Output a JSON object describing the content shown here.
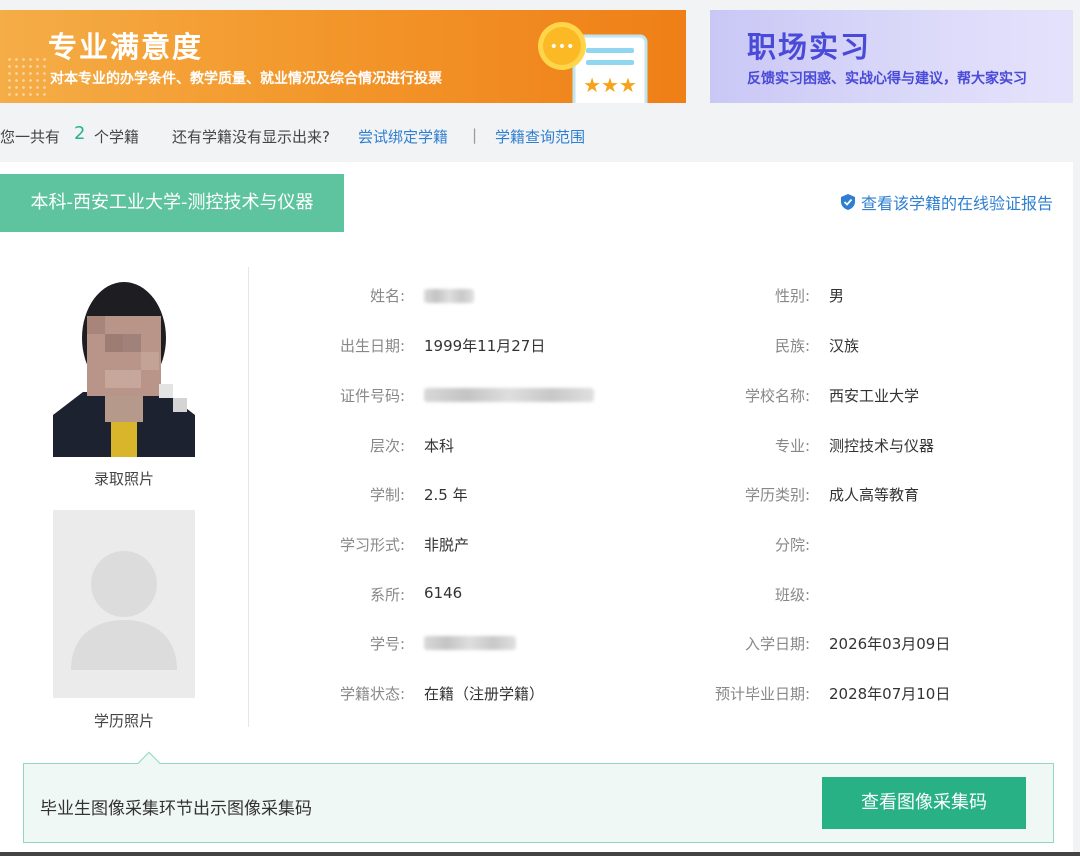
{
  "banners": {
    "satisfaction": {
      "title": "专业满意度",
      "subtitle": "对本专业的办学条件、教学质量、就业情况及综合情况进行投票",
      "bubble_text": "•••"
    },
    "internship": {
      "title": "职场实习",
      "subtitle": "反馈实习困惑、实战心得与建议，帮大家实习"
    }
  },
  "summary": {
    "prefix": "您一共有",
    "count": "2",
    "suffix": "个学籍",
    "hint": "还有学籍没有显示出来?",
    "bind_link": "尝试绑定学籍",
    "separator": "|",
    "scope_link": "学籍查询范围"
  },
  "record": {
    "tab_label": "本科-西安工业大学-测控技术与仪器",
    "verify_link": "查看该学籍的在线验证报告",
    "admission_photo_label": "录取照片",
    "degree_photo_label": "学历照片",
    "fields_left": [
      {
        "label": "姓名:",
        "value": ""
      },
      {
        "label": "出生日期:",
        "value": "1999年11月27日"
      },
      {
        "label": "证件号码:",
        "value": ""
      },
      {
        "label": "层次:",
        "value": "本科"
      },
      {
        "label": "学制:",
        "value": "2.5 年"
      },
      {
        "label": "学习形式:",
        "value": "非脱产"
      },
      {
        "label": "系所:",
        "value": "6146"
      },
      {
        "label": "学号:",
        "value": ""
      },
      {
        "label": "学籍状态:",
        "value": "在籍（注册学籍）"
      }
    ],
    "fields_right": [
      {
        "label": "性别:",
        "value": "男"
      },
      {
        "label": "民族:",
        "value": "汉族"
      },
      {
        "label": "学校名称:",
        "value": "西安工业大学"
      },
      {
        "label": "专业:",
        "value": "测控技术与仪器"
      },
      {
        "label": "学历类别:",
        "value": "成人高等教育"
      },
      {
        "label": "分院:",
        "value": ""
      },
      {
        "label": "班级:",
        "value": ""
      },
      {
        "label": "入学日期:",
        "value": "2026年03月09日"
      },
      {
        "label": "预计毕业日期:",
        "value": "2028年07月10日"
      }
    ]
  },
  "notice": {
    "text": "毕业生图像采集环节出示图像采集码",
    "button": "查看图像采集码"
  },
  "colors": {
    "accent_green": "#5ec4a0",
    "button_green": "#27b184",
    "link_blue": "#2f7fd0",
    "banner_orange": "#f39a2e",
    "banner_purple_text": "#4a4ad8"
  }
}
